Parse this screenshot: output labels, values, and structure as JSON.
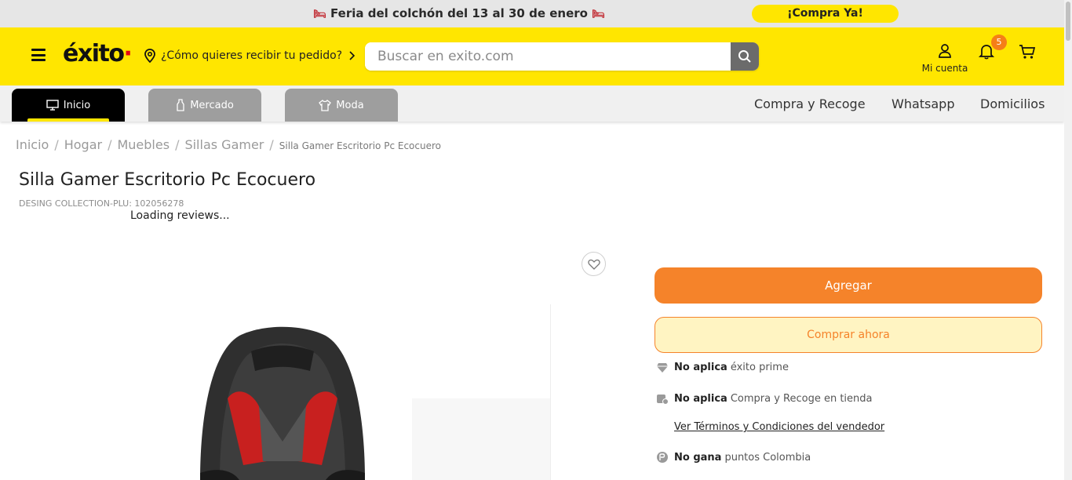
{
  "promo": {
    "text": "Feria del colchón del 13 al 30 de enero",
    "bed_icon": "bed-icon",
    "cta": "¡Compra Ya!"
  },
  "header": {
    "logo": "éxito",
    "location_prompt": "¿Cómo quieres recibir tu pedido?",
    "search_placeholder": "Buscar en exito.com",
    "account_label": "Mi cuenta",
    "notifications_count": "5"
  },
  "nav": {
    "tabs": [
      {
        "label": "Inicio",
        "icon": "monitor-icon",
        "active": true
      },
      {
        "label": "Mercado",
        "icon": "bottle-icon",
        "active": false
      },
      {
        "label": "Moda",
        "icon": "shirt-icon",
        "active": false
      }
    ],
    "links": [
      "Compra y Recoge",
      "Whatsapp",
      "Domicilios"
    ]
  },
  "breadcrumbs": [
    "Inicio",
    "Hogar",
    "Muebles",
    "Sillas Gamer",
    "Silla Gamer Escritorio Pc Ecocuero"
  ],
  "product": {
    "title": "Silla Gamer Escritorio Pc Ecocuero",
    "plu": "DESING COLLECTION-PLU: 102056278",
    "reviews_status": "Loading reviews..."
  },
  "actions": {
    "add_label": "Agregar",
    "buy_label": "Comprar ahora"
  },
  "info": [
    {
      "bold": "No aplica",
      "text": "éxito prime",
      "icon": "diamond-icon"
    },
    {
      "bold": "No aplica",
      "text": "Compra y Recoge en tienda",
      "icon": "store-pickup-icon"
    },
    {
      "bold": "No gana",
      "text": "puntos Colombia",
      "icon": "points-icon"
    }
  ],
  "terms_link": "Ver Términos y Condiciones del vendedor",
  "colors": {
    "brand_yellow": "#ffe600",
    "accent_orange": "#f5832a",
    "badge_orange": "#f57f17"
  }
}
